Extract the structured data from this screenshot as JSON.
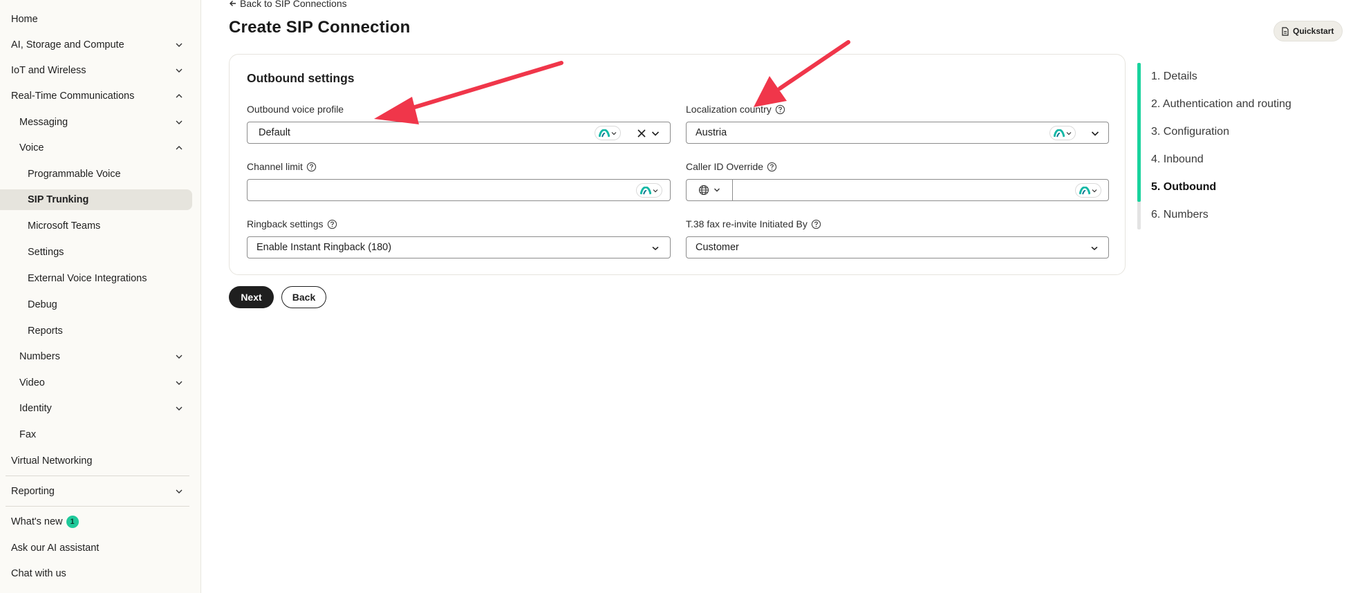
{
  "sidebar": {
    "items": [
      {
        "label": "Home",
        "chevron": "none"
      },
      {
        "label": "AI, Storage and Compute",
        "chevron": "down"
      },
      {
        "label": "IoT and Wireless",
        "chevron": "down"
      },
      {
        "label": "Real-Time Communications",
        "chevron": "up"
      },
      {
        "label": "Messaging",
        "chevron": "down"
      },
      {
        "label": "Voice",
        "chevron": "up"
      },
      {
        "label": "Programmable Voice",
        "chevron": "none"
      },
      {
        "label": "SIP Trunking",
        "chevron": "none",
        "active": true
      },
      {
        "label": "Microsoft Teams",
        "chevron": "none"
      },
      {
        "label": "Settings",
        "chevron": "none"
      },
      {
        "label": "External Voice Integrations",
        "chevron": "none"
      },
      {
        "label": "Debug",
        "chevron": "none"
      },
      {
        "label": "Reports",
        "chevron": "none"
      },
      {
        "label": "Numbers",
        "chevron": "down"
      },
      {
        "label": "Video",
        "chevron": "down"
      },
      {
        "label": "Identity",
        "chevron": "down"
      },
      {
        "label": "Fax",
        "chevron": "none"
      },
      {
        "label": "Virtual Networking",
        "chevron": "none"
      }
    ],
    "reporting": "Reporting",
    "whats_new": "What's new",
    "whats_new_count": "1",
    "ai_assistant": "Ask our AI assistant",
    "chat": "Chat with us"
  },
  "header": {
    "back_link": "Back to SIP Connections",
    "title": "Create SIP Connection",
    "quickstart": "Quickstart"
  },
  "form": {
    "section_title": "Outbound settings",
    "outbound_voice_profile": {
      "label": "Outbound voice profile",
      "value": "Default"
    },
    "localization_country": {
      "label": "Localization country",
      "value": "Austria"
    },
    "channel_limit": {
      "label": "Channel limit",
      "value": ""
    },
    "caller_id_override": {
      "label": "Caller ID Override",
      "value": ""
    },
    "ringback_settings": {
      "label": "Ringback settings",
      "value": "Enable Instant Ringback (180)"
    },
    "t38_fax": {
      "label": "T.38 fax re-invite Initiated By",
      "value": "Customer"
    }
  },
  "actions": {
    "next": "Next",
    "back": "Back"
  },
  "steps": {
    "items": [
      "1. Details",
      "2. Authentication and routing",
      "3. Configuration",
      "4. Inbound",
      "5. Outbound",
      "6. Numbers"
    ],
    "current_index": 4,
    "progress_fraction": 0.833
  },
  "colors": {
    "accent": "#19d39d",
    "annotation_arrow": "#f0364a",
    "primary_button": "#1f1f1f"
  }
}
